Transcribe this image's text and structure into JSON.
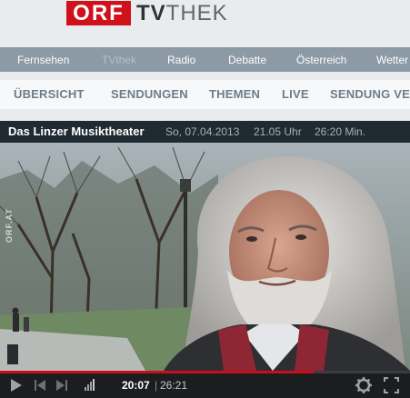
{
  "logo": {
    "orf": "ORF",
    "tv": "TV",
    "thek": "THEK"
  },
  "main_nav": {
    "items": [
      "Fernsehen",
      "TVthek",
      "Radio",
      "Debatte",
      "Österreich",
      "Wetter"
    ]
  },
  "sub_nav": {
    "items": [
      "ÜBERSICHT",
      "SENDUNGEN",
      "THEMEN",
      "LIVE",
      "SENDUNG VE"
    ]
  },
  "video_info": {
    "title": "Das Linzer Musiktheater",
    "date": "So, 07.04.2013",
    "time": "21.05 Uhr",
    "duration": "26:20 Min."
  },
  "video": {
    "watermark": "ORF.AT"
  },
  "player": {
    "current_time": "20:07",
    "separator": "|",
    "total_time": "26:21",
    "progress_fraction": 0.765
  },
  "colors": {
    "brand_red": "#d0111b",
    "nav_bg": "#8c9aa6",
    "title_bar_bg": "#1f2a31"
  }
}
